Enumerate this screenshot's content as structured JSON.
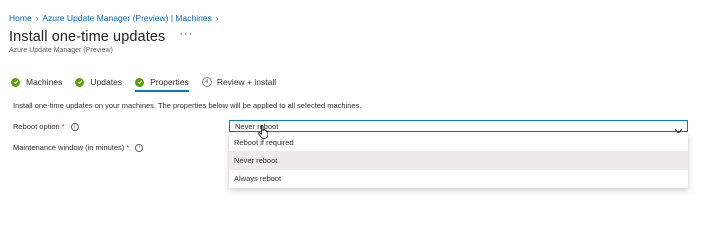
{
  "breadcrumb": {
    "items": [
      "Home",
      "Azure Update Manager (Preview) | Machines"
    ]
  },
  "header": {
    "title": "Install one-time updates",
    "more_label": "···",
    "subtitle": "Azure Update Manager (Preview)"
  },
  "tabs": [
    {
      "label": "Machines",
      "state": "complete"
    },
    {
      "label": "Updates",
      "state": "complete"
    },
    {
      "label": "Properties",
      "state": "complete",
      "active": true
    },
    {
      "label": "Review + install",
      "state": "pending",
      "step": "4"
    }
  ],
  "main": {
    "intro": "Install one-time updates on your machines. The properties below will be applied to all selected machines.",
    "reboot_label": "Reboot option",
    "maintenance_label": "Maintenance window (in minutes)",
    "required_mark": "*",
    "reboot_select": {
      "value": "Never reboot",
      "options": [
        "Reboot if required",
        "Never reboot",
        "Always reboot"
      ],
      "hovered_option": "Never reboot"
    }
  },
  "colors": {
    "link": "#0066cc",
    "accent": "#0078d4",
    "success": "#57a300",
    "required": "#a4262c"
  }
}
